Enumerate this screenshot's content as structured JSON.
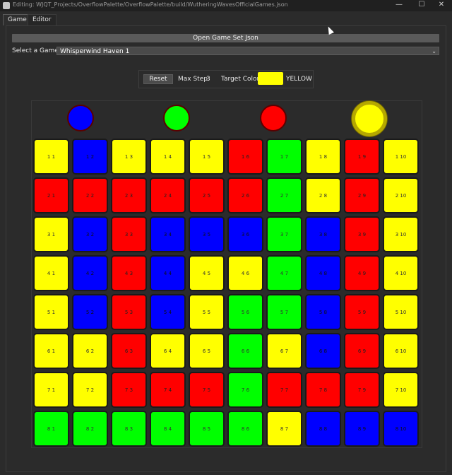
{
  "window": {
    "title": "Editing: WJQT_Projects/OverflowPalette/OverflowPalette/build/WutheringWavesOfficialGames.json",
    "minimize_symbol": "—",
    "maximize_symbol": "☐",
    "close_symbol": "✕"
  },
  "tabs": [
    {
      "label": "Game",
      "active": true
    },
    {
      "label": "Editor",
      "active": false
    }
  ],
  "open_button_label": "Open Game Set Json",
  "select_game": {
    "label": "Select a Game:",
    "value": "Whisperwind Haven 1",
    "chevron": "⌄"
  },
  "controls": {
    "reset_label": "Reset",
    "max_step_label": "Max Step:",
    "max_step_value": "3",
    "target_color_label": "Target Color:",
    "target_color_name": "YELLOW",
    "target_color_hex": "#ffff00"
  },
  "palette": [
    {
      "color": "blue",
      "hex": "#0000ff",
      "selected": false
    },
    {
      "color": "green",
      "hex": "#00ff00",
      "selected": false
    },
    {
      "color": "red",
      "hex": "#ff0000",
      "selected": false
    },
    {
      "color": "yellow",
      "hex": "#ffff00",
      "selected": true
    }
  ],
  "grid_rows": [
    [
      "yellow",
      "blue",
      "yellow",
      "yellow",
      "yellow",
      "red",
      "green",
      "yellow",
      "red",
      "yellow"
    ],
    [
      "red",
      "red",
      "red",
      "red",
      "red",
      "red",
      "green",
      "yellow",
      "red",
      "yellow"
    ],
    [
      "yellow",
      "blue",
      "red",
      "blue",
      "blue",
      "blue",
      "green",
      "blue",
      "red",
      "yellow"
    ],
    [
      "yellow",
      "blue",
      "red",
      "blue",
      "yellow",
      "yellow",
      "green",
      "blue",
      "red",
      "yellow"
    ],
    [
      "yellow",
      "blue",
      "red",
      "blue",
      "yellow",
      "green",
      "green",
      "blue",
      "red",
      "yellow"
    ],
    [
      "yellow",
      "yellow",
      "red",
      "yellow",
      "yellow",
      "green",
      "yellow",
      "blue",
      "red",
      "yellow"
    ],
    [
      "yellow",
      "yellow",
      "red",
      "red",
      "red",
      "green",
      "red",
      "red",
      "red",
      "yellow"
    ],
    [
      "green",
      "green",
      "green",
      "green",
      "green",
      "green",
      "yellow",
      "blue",
      "blue",
      "blue"
    ]
  ],
  "grid_labels": [
    [
      "1 1",
      "1 2",
      "1 3",
      "1 4",
      "1 5",
      "1 6",
      "1 7",
      "1 8",
      "1 9",
      "1 10"
    ],
    [
      "2 1",
      "2 2",
      "2 3",
      "2 4",
      "2 5",
      "2 6",
      "2 7",
      "2 8",
      "2 9",
      "2 10"
    ],
    [
      "3 1",
      "3 2",
      "3 3",
      "3 4",
      "3 5",
      "3 6",
      "3 7",
      "3 8",
      "3 9",
      "3 10"
    ],
    [
      "4 1",
      "4 2",
      "4 3",
      "4 4",
      "4 5",
      "4 6",
      "4 7",
      "4 8",
      "4 9",
      "4 10"
    ],
    [
      "5 1",
      "5 2",
      "5 3",
      "5 4",
      "5 5",
      "5 6",
      "5 7",
      "5 8",
      "5 9",
      "5 10"
    ],
    [
      "6 1",
      "6 2",
      "6 3",
      "6 4",
      "6 5",
      "6 6",
      "6 7",
      "6 8",
      "6 9",
      "6 10"
    ],
    [
      "7 1",
      "7 2",
      "7 3",
      "7 4",
      "7 5",
      "7 6",
      "7 7",
      "7 8",
      "7 9",
      "7 10"
    ],
    [
      "8 1",
      "8 2",
      "8 3",
      "8 4",
      "8 5",
      "8 6",
      "8 7",
      "8 8",
      "8 9",
      "8 10"
    ]
  ]
}
